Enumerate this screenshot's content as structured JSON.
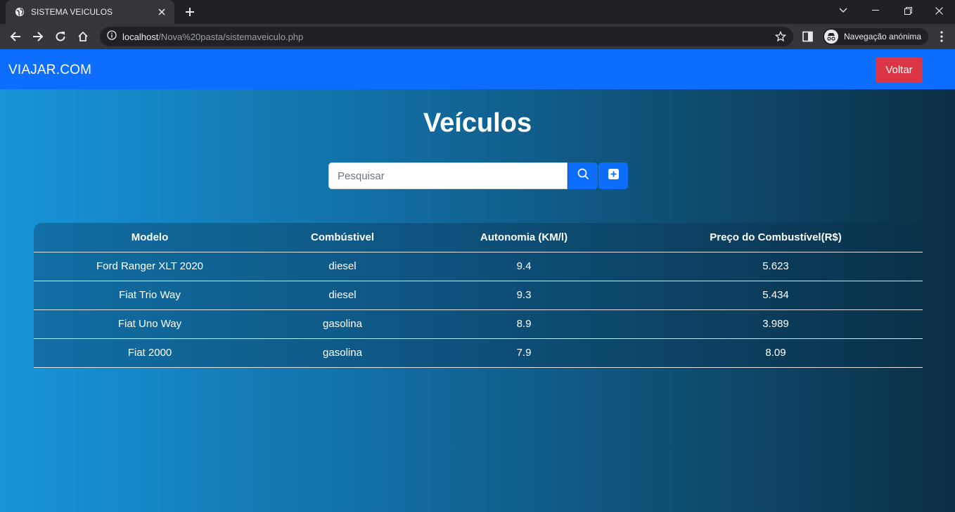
{
  "browser": {
    "tab_title": "SISTEMA VEICULOS",
    "url_host": "localhost",
    "url_path": "/Nova%20pasta/sistemaveiculo.php",
    "incognito_label": "Navegação anónima"
  },
  "navbar": {
    "brand": "VIAJAR.COM",
    "back_button": "Voltar"
  },
  "main": {
    "title": "Veículos",
    "search_placeholder": "Pesquisar"
  },
  "table": {
    "headers": [
      "Modelo",
      "Combústivel",
      "Autonomia (KM/l)",
      "Preço do Combustível(R$)"
    ],
    "rows": [
      [
        "Ford Ranger XLT 2020",
        "diesel",
        "9.4",
        "5.623"
      ],
      [
        "Fiat Trio Way",
        "diesel",
        "9.3",
        "5.434"
      ],
      [
        "Fiat Uno Way",
        "gasolina",
        "8.9",
        "3.989"
      ],
      [
        "Fiat 2000",
        "gasolina",
        "7.9",
        "8.09"
      ]
    ]
  },
  "colors": {
    "navbar": "#0d6efd",
    "back_button": "#dc3545",
    "primary_button": "#0d6efd"
  }
}
